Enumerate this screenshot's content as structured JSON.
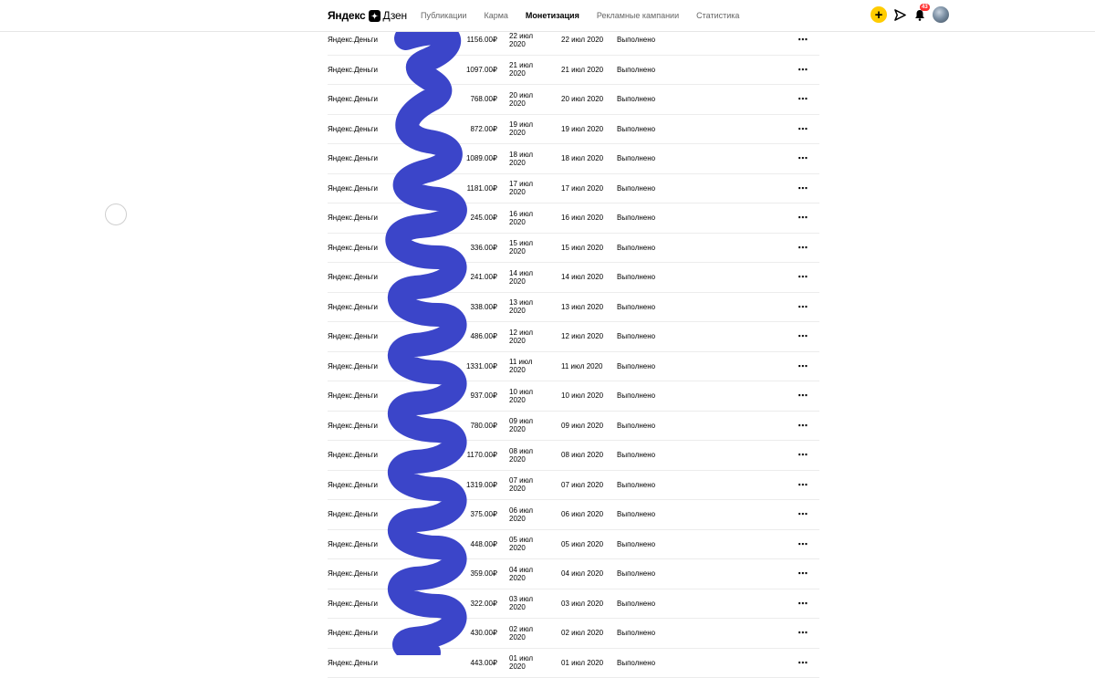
{
  "header": {
    "logo_text": "Яндекс",
    "logo_suffix": "Дзен",
    "nav": [
      "Публикации",
      "Карма",
      "Монетизация",
      "Рекламные кампании",
      "Статистика"
    ],
    "active_nav_index": 2,
    "notification_count": "43",
    "accent_color": "#ffcc00"
  },
  "table": {
    "rows": [
      {
        "method": "Яндекс.Деньги",
        "amount": "1156.00₽",
        "created_day": "22 июл",
        "created_year": "2020",
        "paid": "22 июл 2020",
        "status": "Выполнено"
      },
      {
        "method": "Яндекс.Деньги",
        "amount": "1097.00₽",
        "created_day": "21 июл",
        "created_year": "2020",
        "paid": "21 июл 2020",
        "status": "Выполнено"
      },
      {
        "method": "Яндекс.Деньги",
        "amount": "768.00₽",
        "created_day": "20 июл",
        "created_year": "2020",
        "paid": "20 июл 2020",
        "status": "Выполнено"
      },
      {
        "method": "Яндекс.Деньги",
        "amount": "872.00₽",
        "created_day": "19 июл",
        "created_year": "2020",
        "paid": "19 июл 2020",
        "status": "Выполнено"
      },
      {
        "method": "Яндекс.Деньги",
        "amount": "1089.00₽",
        "created_day": "18 июл",
        "created_year": "2020",
        "paid": "18 июл 2020",
        "status": "Выполнено"
      },
      {
        "method": "Яндекс.Деньги",
        "amount": "1181.00₽",
        "created_day": "17 июл",
        "created_year": "2020",
        "paid": "17 июл 2020",
        "status": "Выполнено"
      },
      {
        "method": "Яндекс.Деньги",
        "amount": "245.00₽",
        "created_day": "16 июл",
        "created_year": "2020",
        "paid": "16 июл 2020",
        "status": "Выполнено"
      },
      {
        "method": "Яндекс.Деньги",
        "amount": "336.00₽",
        "created_day": "15 июл",
        "created_year": "2020",
        "paid": "15 июл 2020",
        "status": "Выполнено"
      },
      {
        "method": "Яндекс.Деньги",
        "amount": "241.00₽",
        "created_day": "14 июл",
        "created_year": "2020",
        "paid": "14 июл 2020",
        "status": "Выполнено"
      },
      {
        "method": "Яндекс.Деньги",
        "amount": "338.00₽",
        "created_day": "13 июл",
        "created_year": "2020",
        "paid": "13 июл 2020",
        "status": "Выполнено"
      },
      {
        "method": "Яндекс.Деньги",
        "amount": "486.00₽",
        "created_day": "12 июл",
        "created_year": "2020",
        "paid": "12 июл 2020",
        "status": "Выполнено"
      },
      {
        "method": "Яндекс.Деньги",
        "amount": "1331.00₽",
        "created_day": "11 июл",
        "created_year": "2020",
        "paid": "11 июл 2020",
        "status": "Выполнено"
      },
      {
        "method": "Яндекс.Деньги",
        "amount": "937.00₽",
        "created_day": "10 июл",
        "created_year": "2020",
        "paid": "10 июл 2020",
        "status": "Выполнено"
      },
      {
        "method": "Яндекс.Деньги",
        "amount": "780.00₽",
        "created_day": "09 июл",
        "created_year": "2020",
        "paid": "09 июл 2020",
        "status": "Выполнено"
      },
      {
        "method": "Яндекс.Деньги",
        "amount": "1170.00₽",
        "created_day": "08 июл",
        "created_year": "2020",
        "paid": "08 июл 2020",
        "status": "Выполнено"
      },
      {
        "method": "Яндекс.Деньги",
        "amount": "1319.00₽",
        "created_day": "07 июл",
        "created_year": "2020",
        "paid": "07 июл 2020",
        "status": "Выполнено"
      },
      {
        "method": "Яндекс.Деньги",
        "amount": "375.00₽",
        "created_day": "06 июл",
        "created_year": "2020",
        "paid": "06 июл 2020",
        "status": "Выполнено"
      },
      {
        "method": "Яндекс.Деньги",
        "amount": "448.00₽",
        "created_day": "05 июл",
        "created_year": "2020",
        "paid": "05 июл 2020",
        "status": "Выполнено"
      },
      {
        "method": "Яндекс.Деньги",
        "amount": "359.00₽",
        "created_day": "04 июл",
        "created_year": "2020",
        "paid": "04 июл 2020",
        "status": "Выполнено"
      },
      {
        "method": "Яндекс.Деньги",
        "amount": "322.00₽",
        "created_day": "03 июл",
        "created_year": "2020",
        "paid": "03 июл 2020",
        "status": "Выполнено"
      },
      {
        "method": "Яндекс.Деньги",
        "amount": "430.00₽",
        "created_day": "02 июл",
        "created_year": "2020",
        "paid": "02 июл 2020",
        "status": "Выполнено"
      },
      {
        "method": "Яндекс.Деньги",
        "amount": "443.00₽",
        "created_day": "01 июл",
        "created_year": "2020",
        "paid": "01 июл 2020",
        "status": "Выполнено"
      }
    ],
    "row_menu_label": "⋯"
  },
  "scribble_color": "#3b45c9"
}
